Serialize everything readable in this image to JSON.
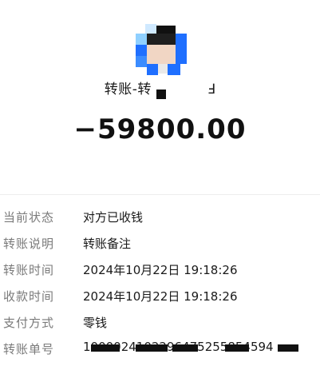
{
  "header": {
    "title_prefix": "转账-转",
    "title_suffix": "Ⅎ",
    "amount": "−59800.00"
  },
  "details": [
    {
      "label": "当前状态",
      "value": "对方已收钱"
    },
    {
      "label": "转账说明",
      "value": "转账备注"
    },
    {
      "label": "转账时间",
      "value": "2024年10月22日 19:18:26"
    },
    {
      "label": "收款时间",
      "value": "2024年10月22日 19:18:26"
    },
    {
      "label": "支付方式",
      "value": "零钱"
    }
  ],
  "transfer_number": {
    "label": "转账单号",
    "visible_part": "1000024102296475255854594"
  },
  "colors": {
    "label": "#7a7a7a",
    "text": "#1a1a1a",
    "avatar_blue": "#1f6fff",
    "avatar_light_blue": "#8fd0ff"
  },
  "icons": {
    "avatar": "pixelated-avatar-icon"
  }
}
